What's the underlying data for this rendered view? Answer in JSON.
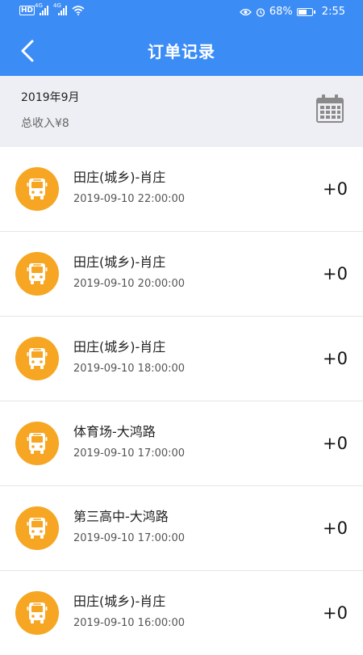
{
  "status_bar": {
    "hd_badge": "HD",
    "network_1": "4G",
    "network_2": "4G",
    "battery_percent": "68%",
    "battery_level": 0.68,
    "time": "2:55"
  },
  "header": {
    "title": "订单记录",
    "back_icon": "chevron-left-icon"
  },
  "summary": {
    "month": "2019年9月",
    "total_income": "总收入¥8",
    "calendar_icon": "calendar-icon"
  },
  "orders": [
    {
      "route": "田庄(城乡)-肖庄",
      "datetime": "2019-09-10 22:00:00",
      "amount": "+0"
    },
    {
      "route": "田庄(城乡)-肖庄",
      "datetime": "2019-09-10 20:00:00",
      "amount": "+0"
    },
    {
      "route": "田庄(城乡)-肖庄",
      "datetime": "2019-09-10 18:00:00",
      "amount": "+0"
    },
    {
      "route": "体育场-大鸿路",
      "datetime": "2019-09-10 17:00:00",
      "amount": "+0"
    },
    {
      "route": "第三高中-大鸿路",
      "datetime": "2019-09-10 17:00:00",
      "amount": "+0"
    },
    {
      "route": "田庄(城乡)-肖庄",
      "datetime": "2019-09-10 16:00:00",
      "amount": "+0"
    }
  ],
  "colors": {
    "header_blue": "#3c8cf6",
    "bus_icon_orange": "#f6a623",
    "summary_bg": "#eeeff4"
  }
}
